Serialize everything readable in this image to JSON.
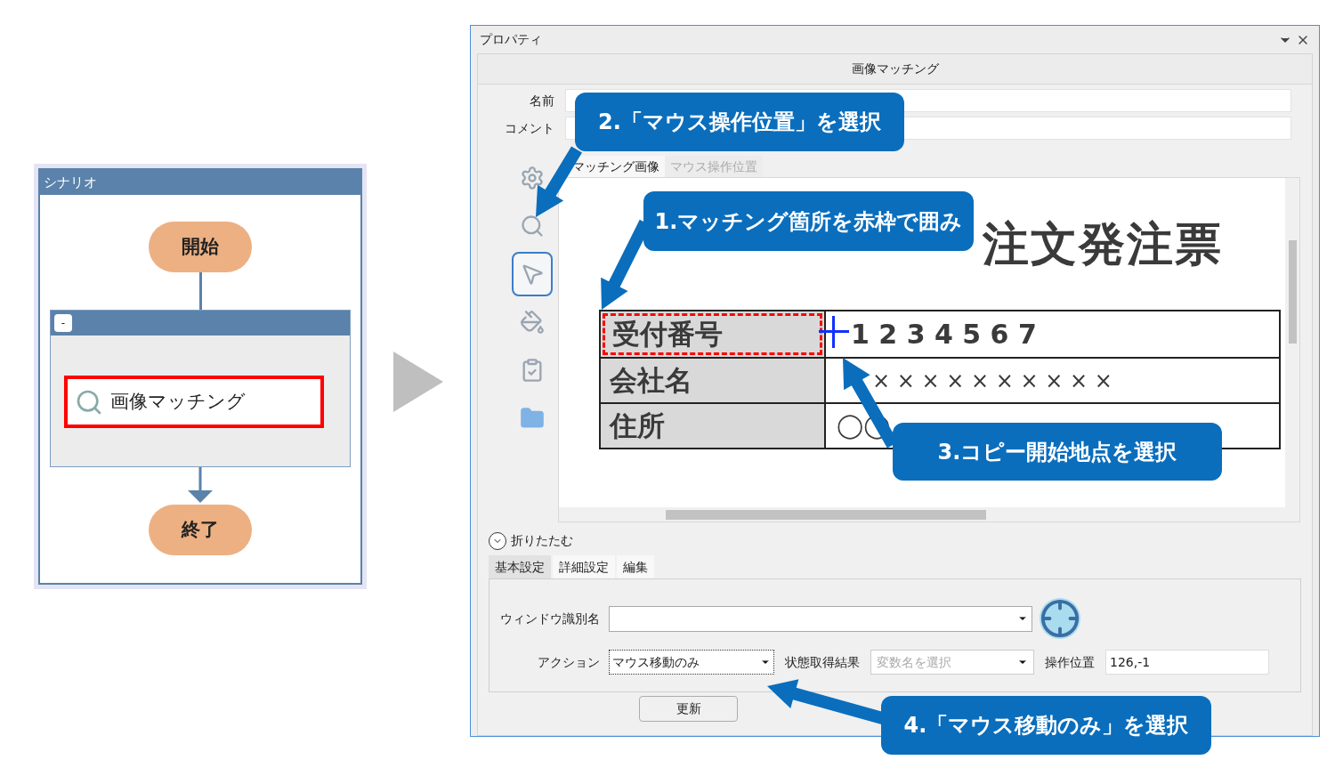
{
  "scenario": {
    "title": "シナリオ",
    "start": "開始",
    "group": {
      "collapse_button": "-",
      "activity": {
        "label": "画像マッチング",
        "highlighted": true
      }
    },
    "end": "終了"
  },
  "properties": {
    "title": "プロパティ",
    "activity_title": "画像マッチング",
    "fields": [
      {
        "label": "名前"
      },
      {
        "label": "コメント"
      }
    ],
    "tools": [
      {
        "kind": "gear",
        "selected": false
      },
      {
        "kind": "search",
        "selected": false
      },
      {
        "kind": "pointer",
        "selected": true
      },
      {
        "kind": "paint",
        "selected": false
      },
      {
        "kind": "clipboard",
        "selected": false
      },
      {
        "kind": "folder",
        "selected": false
      }
    ],
    "image_tabs": [
      {
        "label": "マッチング画像",
        "selected": true
      },
      {
        "label": "マウス操作位置",
        "selected": false
      }
    ],
    "image": {
      "title": "注文発注票",
      "rows": [
        {
          "label": "受付番号",
          "value": "1 2 3 4 5 6 7",
          "matched": true
        },
        {
          "label": "会社名",
          "value": "× × × × × × × × × ×",
          "matched": false
        },
        {
          "label": "住所",
          "value": "◯◯",
          "matched": false
        }
      ]
    },
    "collapse": {
      "label": "折りたたむ",
      "expanded": true
    },
    "settings_tabs": [
      {
        "label": "基本設定",
        "selected": true
      },
      {
        "label": "詳細設定",
        "selected": false
      },
      {
        "label": "編集",
        "selected": false
      }
    ],
    "settings": {
      "window_name": {
        "label": "ウィンドウ識別名"
      },
      "action": {
        "label": "アクション",
        "value": "マウス移動のみ"
      },
      "state_result": {
        "label": "状態取得結果",
        "placeholder": "変数名を選択"
      },
      "position": {
        "label": "操作位置",
        "value": "126,-1"
      }
    },
    "update_button": "更新"
  },
  "callouts": [
    {
      "text": "2.「マウス操作位置」を選択"
    },
    {
      "text": "1.マッチング箇所を赤枠で囲み"
    },
    {
      "text": "3.コピー開始地点を選択"
    },
    {
      "text": "4.「マウス移動のみ」を選択"
    }
  ]
}
